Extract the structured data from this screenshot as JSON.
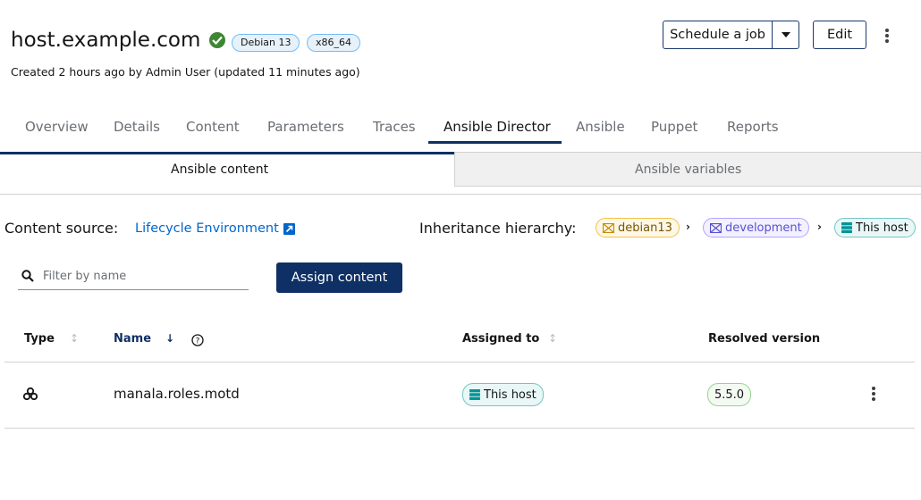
{
  "header": {
    "host_name": "host.example.com",
    "badges": [
      "Debian 13",
      "x86_64"
    ],
    "created_text": "Created 2 hours ago by Admin User (updated 11 minutes ago)",
    "schedule_label": "Schedule a job",
    "edit_label": "Edit"
  },
  "tabs": [
    {
      "label": "Overview",
      "active": false
    },
    {
      "label": "Details",
      "active": false
    },
    {
      "label": "Content",
      "active": false
    },
    {
      "label": "Parameters",
      "active": false
    },
    {
      "label": "Traces",
      "active": false
    },
    {
      "label": "Ansible Director",
      "active": true
    },
    {
      "label": "Ansible",
      "active": false
    },
    {
      "label": "Puppet",
      "active": false
    },
    {
      "label": "Reports",
      "active": false
    }
  ],
  "subtabs": [
    {
      "label": "Ansible content",
      "active": true
    },
    {
      "label": "Ansible variables",
      "active": false
    }
  ],
  "content_source": {
    "label": "Content source:",
    "link": "Lifecycle Environment"
  },
  "inheritance": {
    "label": "Inheritance hierarchy:",
    "chips": [
      "debian13",
      "development",
      "This host"
    ]
  },
  "filter": {
    "placeholder": "Filter by name",
    "value": ""
  },
  "assign_label": "Assign content",
  "table": {
    "columns": [
      "Type",
      "Name",
      "Assigned to",
      "Resolved version"
    ],
    "rows": [
      {
        "type_icon": "roles-icon",
        "name": "manala.roles.motd",
        "assigned_to": "This host",
        "version": "5.5.0"
      }
    ]
  },
  "colors": {
    "primary": "#0f3064",
    "link": "#0066cc",
    "success": "#3e8635"
  }
}
